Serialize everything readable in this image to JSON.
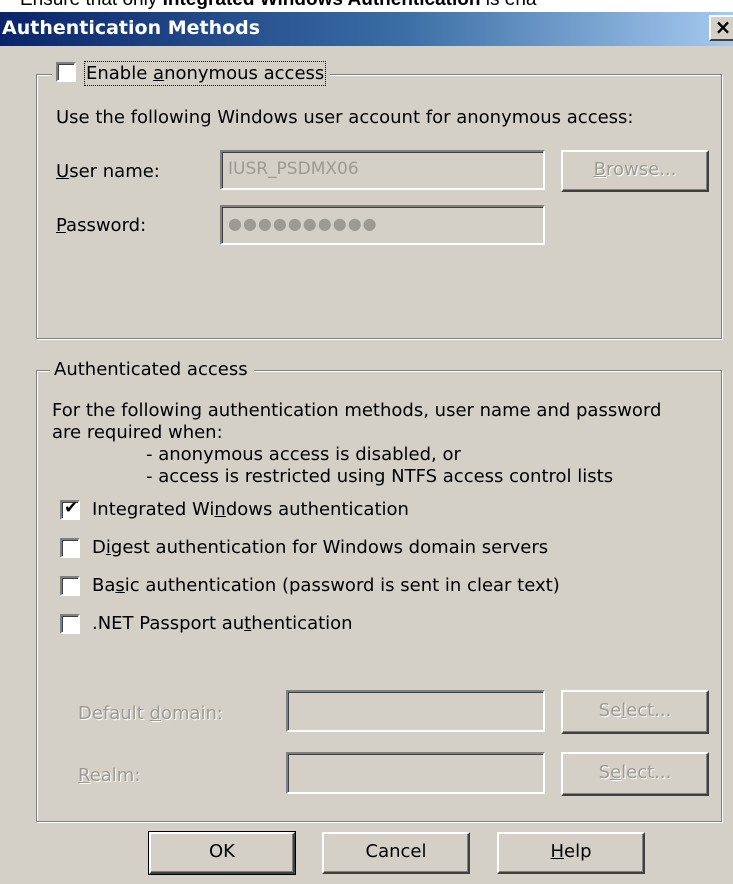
{
  "caption": {
    "prefix": "Ensure that only ",
    "bold": "Integrated Windows Authentication",
    "suffix": " is ena"
  },
  "window": {
    "title": "Authentication Methods",
    "close_glyph": "×"
  },
  "anonymous": {
    "enable_label": "Enable anonymous access",
    "enable_checked": false,
    "description": "Use the following Windows user account for anonymous access:",
    "username_label": "User name:",
    "username_value": "IUSR_PSDMX06",
    "browse_label": "Browse...",
    "password_label": "Password:",
    "password_value": "●●●●●●●●●●"
  },
  "authenticated": {
    "legend": "Authenticated access",
    "description_line1": "For the following authentication methods, user name and password",
    "description_line2": "are required when:",
    "bullet1": "- anonymous access is disabled, or",
    "bullet2": "- access is restricted using NTFS access control lists",
    "methods": [
      {
        "label": "Integrated Windows authentication",
        "checked": true
      },
      {
        "label": "Digest authentication for Windows domain servers",
        "checked": false
      },
      {
        "label": "Basic authentication (password is sent in clear text)",
        "checked": false
      },
      {
        "label": ".NET Passport authentication",
        "checked": false
      }
    ],
    "default_domain_label": "Default domain:",
    "default_domain_value": "",
    "realm_label": "Realm:",
    "realm_value": "",
    "select_label": "Select..."
  },
  "buttons": {
    "ok": "OK",
    "cancel": "Cancel",
    "help": "Help"
  },
  "colors": {
    "dialog_bg": "#d4d0c8",
    "titlebar_start": "#0a246a",
    "titlebar_end": "#a6caf0",
    "disabled_text": "#9c9a92"
  }
}
